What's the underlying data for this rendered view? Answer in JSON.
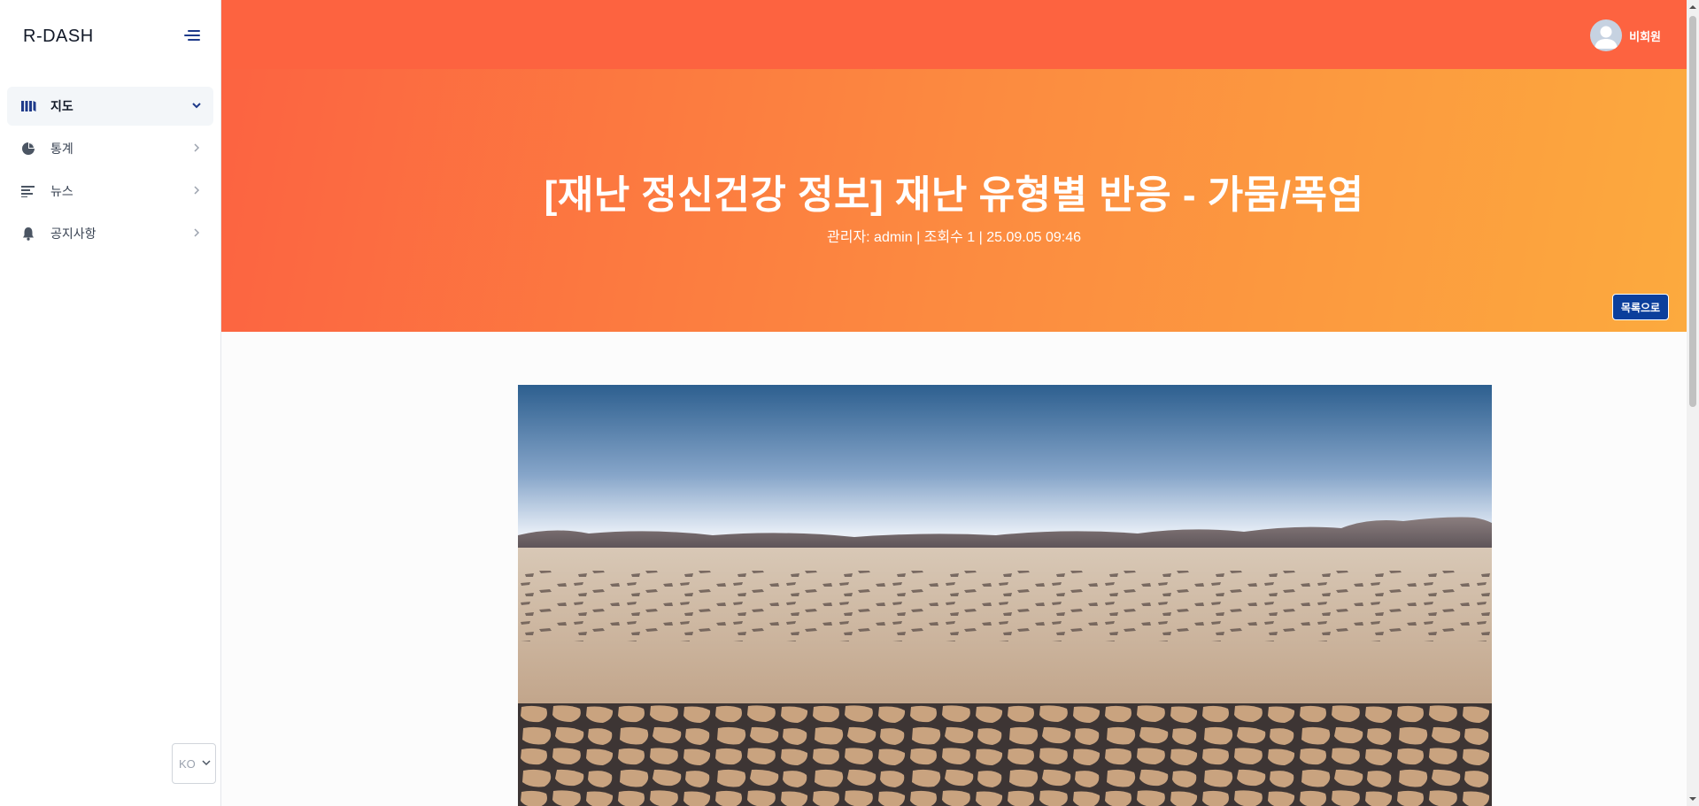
{
  "app": {
    "logo": "R-DASH"
  },
  "sidebar": {
    "items": [
      {
        "label": "지도",
        "icon": "map-icon",
        "active": true
      },
      {
        "label": "통계",
        "icon": "pie-chart-icon",
        "active": false
      },
      {
        "label": "뉴스",
        "icon": "news-icon",
        "active": false
      },
      {
        "label": "공지사항",
        "icon": "bell-icon",
        "active": false
      }
    ],
    "language": "KO"
  },
  "header": {
    "user_name": "비회원"
  },
  "post": {
    "title": "[재난 정신건강 정보] 재난 유형별 반응 - 가뭄/폭염",
    "meta": "관리자: admin | 조회수 1 | 25.09.05 09:46",
    "back_button": "목록으로"
  },
  "colors": {
    "accent": "#fd6340",
    "gradient_start": "#fc6341",
    "gradient_end": "#fcaa3e",
    "button": "#0b3f9c",
    "nav_icon": "#1e3a8a"
  }
}
